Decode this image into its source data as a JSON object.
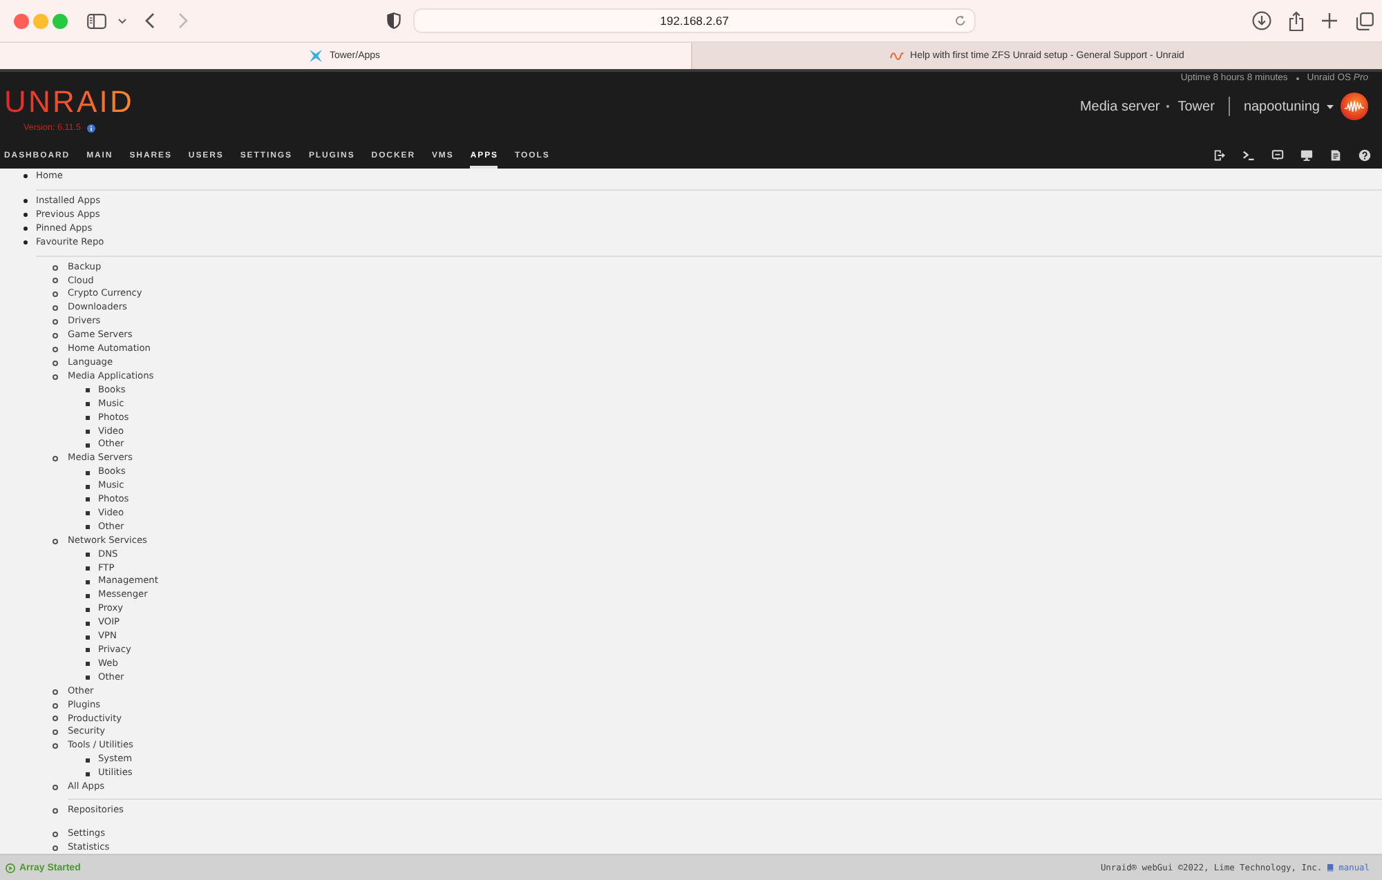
{
  "browser": {
    "address": "192.168.2.67",
    "tabs": [
      {
        "title": "Tower/Apps",
        "selected": true
      },
      {
        "title": "Help with first time ZFS Unraid setup - General Support - Unraid",
        "selected": false
      }
    ]
  },
  "header": {
    "logo": "UNRAID",
    "version": "Version: 6.11.5",
    "uptime": "Uptime 8 hours 8 minutes",
    "license": "Unraid OS *Pro*",
    "server_description": "Media server",
    "server_name": "Tower",
    "user": "napootuning"
  },
  "nav": [
    {
      "label": "DASHBOARD",
      "selected": false
    },
    {
      "label": "MAIN",
      "selected": false
    },
    {
      "label": "SHARES",
      "selected": false
    },
    {
      "label": "USERS",
      "selected": false
    },
    {
      "label": "SETTINGS",
      "selected": false
    },
    {
      "label": "PLUGINS",
      "selected": false
    },
    {
      "label": "DOCKER",
      "selected": false
    },
    {
      "label": "VMS",
      "selected": false
    },
    {
      "label": "APPS",
      "selected": true
    },
    {
      "label": "TOOLS",
      "selected": false
    }
  ],
  "menu": {
    "home": [
      {
        "label": "Home"
      }
    ],
    "app_lists": [
      {
        "label": "Installed Apps"
      },
      {
        "label": "Previous Apps"
      },
      {
        "label": "Pinned Apps"
      },
      {
        "label": "Favourite Repo"
      }
    ],
    "categories": [
      {
        "label": "Backup"
      },
      {
        "label": "Cloud"
      },
      {
        "label": "Crypto Currency"
      },
      {
        "label": "Downloaders"
      },
      {
        "label": "Drivers"
      },
      {
        "label": "Game Servers"
      },
      {
        "label": "Home Automation"
      },
      {
        "label": "Language"
      },
      {
        "label": "Media Applications",
        "children": [
          {
            "label": "Books"
          },
          {
            "label": "Music"
          },
          {
            "label": "Photos"
          },
          {
            "label": "Video"
          },
          {
            "label": "Other"
          }
        ]
      },
      {
        "label": "Media Servers",
        "children": [
          {
            "label": "Books"
          },
          {
            "label": "Music"
          },
          {
            "label": "Photos"
          },
          {
            "label": "Video"
          },
          {
            "label": "Other"
          }
        ]
      },
      {
        "label": "Network Services",
        "children": [
          {
            "label": "DNS"
          },
          {
            "label": "FTP"
          },
          {
            "label": "Management"
          },
          {
            "label": "Messenger"
          },
          {
            "label": "Proxy"
          },
          {
            "label": "VOIP"
          },
          {
            "label": "VPN"
          },
          {
            "label": "Privacy"
          },
          {
            "label": "Web"
          },
          {
            "label": "Other"
          }
        ]
      },
      {
        "label": "Other"
      },
      {
        "label": "Plugins"
      },
      {
        "label": "Productivity"
      },
      {
        "label": "Security"
      },
      {
        "label": "Tools / Utilities",
        "children": [
          {
            "label": "System"
          },
          {
            "label": "Utilities"
          }
        ]
      },
      {
        "label": "All Apps"
      }
    ],
    "repositories": [
      {
        "label": "Repositories"
      }
    ],
    "more": [
      {
        "label": "Settings"
      },
      {
        "label": "Statistics"
      }
    ]
  },
  "status_bar": {
    "array_status": "Array Started",
    "copyright": "Unraid® webGui ©2022, Lime Technology, Inc.",
    "manual_link": "manual"
  }
}
